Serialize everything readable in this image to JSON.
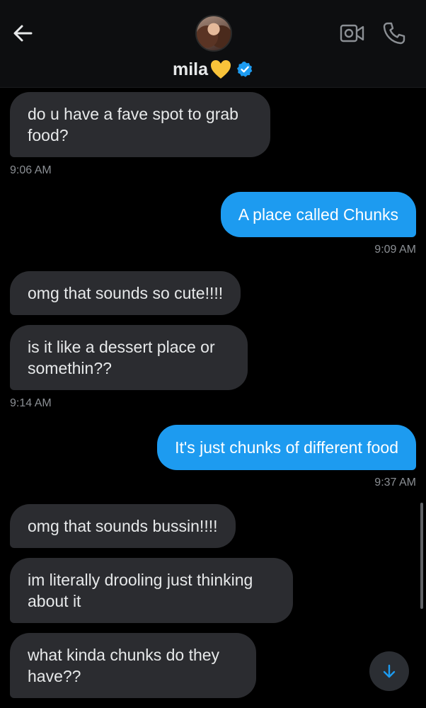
{
  "header": {
    "contact_name": "mila",
    "heart_color": "#f8c33a",
    "verified_color": "#1d9bf0",
    "icons": [
      "back-arrow-icon",
      "video-call-icon",
      "phone-icon",
      "verified-badge-icon",
      "yellow-heart-icon"
    ]
  },
  "messages": [
    {
      "side": "in",
      "text": "do u have a fave spot to grab\nfood?"
    },
    {
      "side": "in",
      "time": "9:06 AM"
    },
    {
      "side": "out",
      "text": "A place called Chunks"
    },
    {
      "side": "out",
      "time": "9:09 AM"
    },
    {
      "side": "in",
      "text": "omg that sounds so cute!!!!"
    },
    {
      "side": "in",
      "text": "is it like a dessert place or\nsomethin??"
    },
    {
      "side": "in",
      "time": "9:14 AM"
    },
    {
      "side": "out",
      "text": "It's just chunks of different food"
    },
    {
      "side": "out",
      "time": "9:37 AM"
    },
    {
      "side": "in",
      "text": "omg that sounds bussin!!!!"
    },
    {
      "side": "in",
      "text": "im literally drooling just thinking\nabout it"
    },
    {
      "side": "in",
      "text": "what kinda chunks do they\nhave??"
    }
  ],
  "colors": {
    "background": "#000000",
    "incoming_bubble": "#2b2c30",
    "outgoing_bubble": "#1d9bf0",
    "timestamp": "#8b8f94"
  }
}
